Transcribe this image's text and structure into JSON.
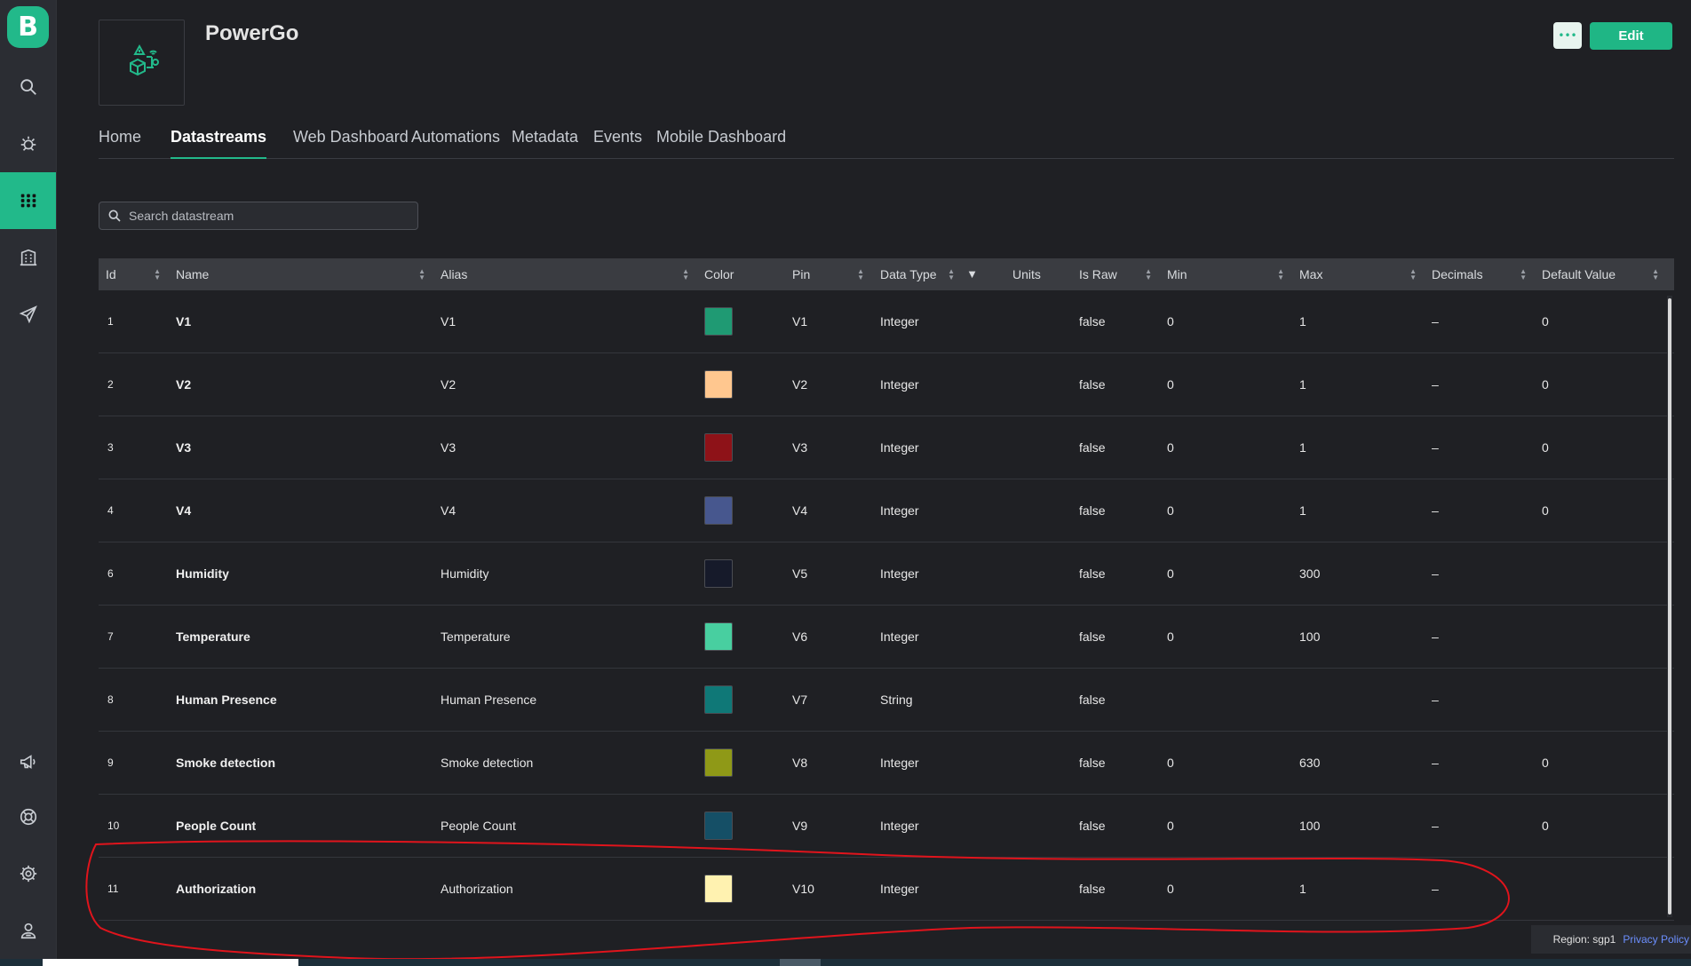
{
  "sidebar": {
    "logo": "B",
    "icons": [
      "search-icon",
      "bug-icon",
      "grid-icon",
      "building-icon",
      "send-icon",
      "megaphone-icon",
      "lifebuoy-icon",
      "gear-icon",
      "user-badge-icon"
    ]
  },
  "header": {
    "title": "PowerGo",
    "more_label": "•••",
    "edit_label": "Edit"
  },
  "tabs": [
    {
      "label": "Home"
    },
    {
      "label": "Datastreams"
    },
    {
      "label": "Web Dashboard"
    },
    {
      "label": "Automations"
    },
    {
      "label": "Metadata"
    },
    {
      "label": "Events"
    },
    {
      "label": "Mobile Dashboard"
    }
  ],
  "search": {
    "placeholder": "Search datastream"
  },
  "table": {
    "columns": [
      "Id",
      "Name",
      "Alias",
      "Color",
      "Pin",
      "Data Type",
      "Units",
      "Is Raw",
      "Min",
      "Max",
      "Decimals",
      "Default Value"
    ],
    "rows": [
      {
        "id": "1",
        "name": "V1",
        "alias": "V1",
        "color": "#1f9a73",
        "pin": "V1",
        "type": "Integer",
        "units": "",
        "raw": "false",
        "min": "0",
        "max": "1",
        "dec": "–",
        "def": "0"
      },
      {
        "id": "2",
        "name": "V2",
        "alias": "V2",
        "color": "#ffc78f",
        "pin": "V2",
        "type": "Integer",
        "units": "",
        "raw": "false",
        "min": "0",
        "max": "1",
        "dec": "–",
        "def": "0"
      },
      {
        "id": "3",
        "name": "V3",
        "alias": "V3",
        "color": "#8e1218",
        "pin": "V3",
        "type": "Integer",
        "units": "",
        "raw": "false",
        "min": "0",
        "max": "1",
        "dec": "–",
        "def": "0"
      },
      {
        "id": "4",
        "name": "V4",
        "alias": "V4",
        "color": "#47578e",
        "pin": "V4",
        "type": "Integer",
        "units": "",
        "raw": "false",
        "min": "0",
        "max": "1",
        "dec": "–",
        "def": "0"
      },
      {
        "id": "6",
        "name": "Humidity",
        "alias": "Humidity",
        "color": "#161a2a",
        "pin": "V5",
        "type": "Integer",
        "units": "",
        "raw": "false",
        "min": "0",
        "max": "300",
        "dec": "–",
        "def": ""
      },
      {
        "id": "7",
        "name": "Temperature",
        "alias": "Temperature",
        "color": "#48cfa0",
        "pin": "V6",
        "type": "Integer",
        "units": "",
        "raw": "false",
        "min": "0",
        "max": "100",
        "dec": "–",
        "def": ""
      },
      {
        "id": "8",
        "name": "Human Presence",
        "alias": "Human Presence",
        "color": "#0f7877",
        "pin": "V7",
        "type": "String",
        "units": "",
        "raw": "false",
        "min": "",
        "max": "",
        "dec": "–",
        "def": ""
      },
      {
        "id": "9",
        "name": "Smoke detection",
        "alias": "Smoke detection",
        "color": "#8f9917",
        "pin": "V8",
        "type": "Integer",
        "units": "",
        "raw": "false",
        "min": "0",
        "max": "630",
        "dec": "–",
        "def": "0"
      },
      {
        "id": "10",
        "name": "People Count",
        "alias": "People Count",
        "color": "#154f66",
        "pin": "V9",
        "type": "Integer",
        "units": "",
        "raw": "false",
        "min": "0",
        "max": "100",
        "dec": "–",
        "def": "0"
      },
      {
        "id": "11",
        "name": "Authorization",
        "alias": "Authorization",
        "color": "#fff2b0",
        "pin": "V10",
        "type": "Integer",
        "units": "",
        "raw": "false",
        "min": "0",
        "max": "1",
        "dec": "–",
        "def": ""
      }
    ]
  },
  "footer": {
    "region": "Region: sgp1",
    "privacy": "Privacy Policy"
  },
  "colors": {
    "accent": "#22b98a",
    "annotation": "#e0141c"
  }
}
